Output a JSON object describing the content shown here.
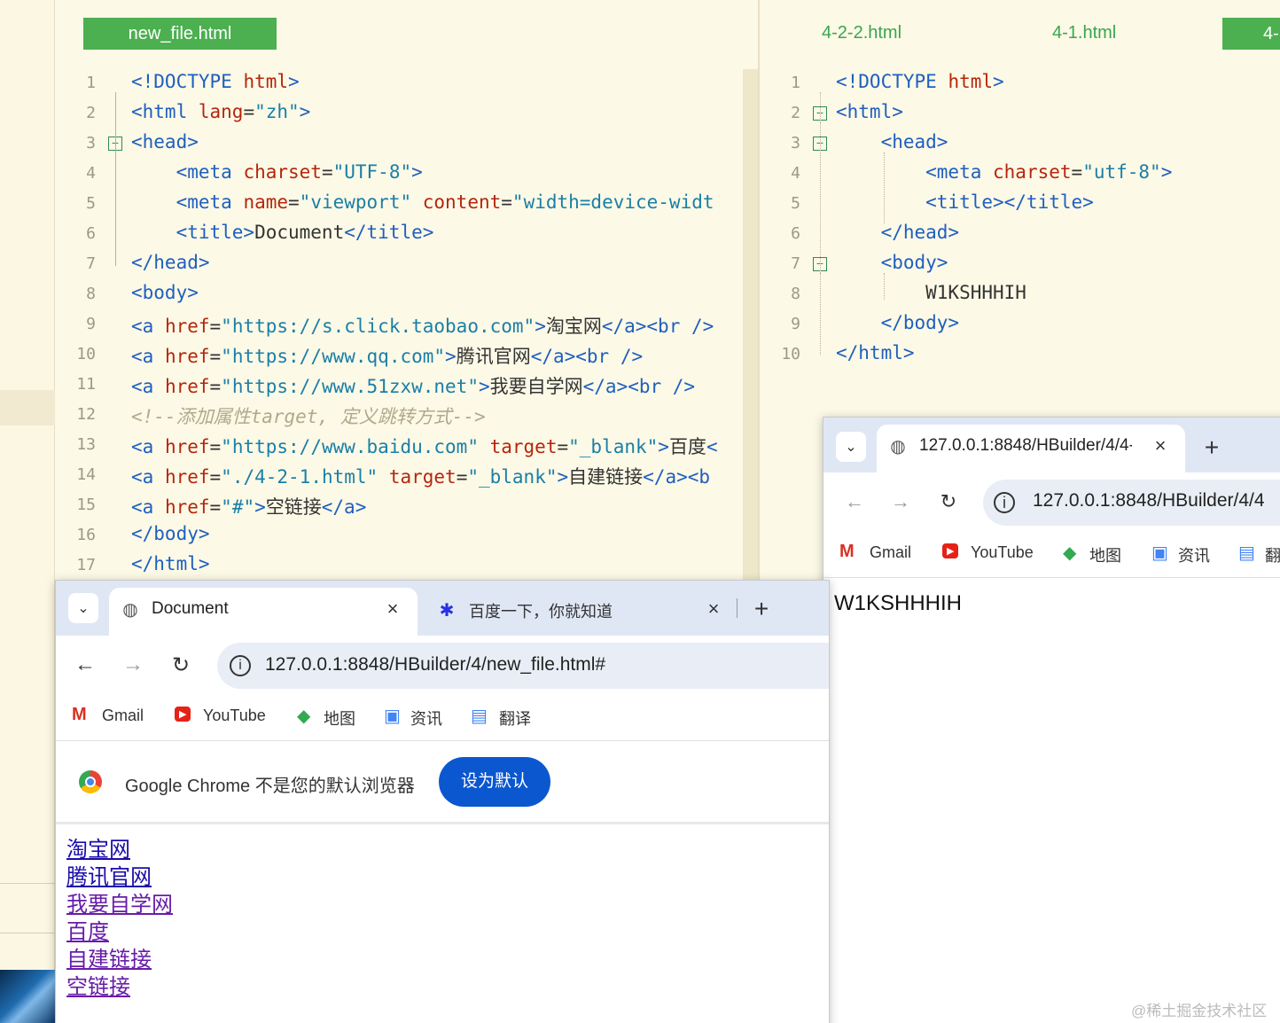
{
  "left_editor": {
    "tab": "new_file.html",
    "lines": [
      {
        "n": "1",
        "parts": [
          [
            "tg",
            "<!DOCTYPE "
          ],
          [
            "at",
            "html"
          ],
          [
            "tg",
            ">"
          ]
        ]
      },
      {
        "n": "2",
        "parts": [
          [
            "tg",
            "<html "
          ],
          [
            "at",
            "lang"
          ],
          [
            "tx",
            "="
          ],
          [
            "vl",
            "\"zh\""
          ],
          [
            "tg",
            ">"
          ]
        ]
      },
      {
        "n": "3",
        "parts": [
          [
            "tg",
            "<head>"
          ]
        ]
      },
      {
        "n": "4",
        "parts": [
          [
            "tg",
            "    <meta "
          ],
          [
            "at",
            "charset"
          ],
          [
            "tx",
            "="
          ],
          [
            "vl",
            "\"UTF-8\""
          ],
          [
            "tg",
            ">"
          ]
        ]
      },
      {
        "n": "5",
        "parts": [
          [
            "tg",
            "    <meta "
          ],
          [
            "at",
            "name"
          ],
          [
            "tx",
            "="
          ],
          [
            "vl",
            "\"viewport\" "
          ],
          [
            "at",
            "content"
          ],
          [
            "tx",
            "="
          ],
          [
            "vl",
            "\"width=device-widt"
          ]
        ]
      },
      {
        "n": "6",
        "parts": [
          [
            "tg",
            "    <title>"
          ],
          [
            "tx",
            "Document"
          ],
          [
            "tg",
            "</title>"
          ]
        ]
      },
      {
        "n": "7",
        "parts": [
          [
            "tg",
            "</head>"
          ]
        ]
      },
      {
        "n": "8",
        "parts": [
          [
            "tg",
            "<body>"
          ]
        ]
      },
      {
        "n": "9",
        "parts": [
          [
            "tg",
            "<a "
          ],
          [
            "at",
            "href"
          ],
          [
            "tx",
            "="
          ],
          [
            "vl",
            "\"https://s.click.taobao.com\""
          ],
          [
            "tg",
            ">"
          ],
          [
            "tx",
            "淘宝网"
          ],
          [
            "tg",
            "</a><br />"
          ]
        ]
      },
      {
        "n": "10",
        "parts": [
          [
            "tg",
            "<a "
          ],
          [
            "at",
            "href"
          ],
          [
            "tx",
            "="
          ],
          [
            "vl",
            "\"https://www.qq.com\""
          ],
          [
            "tg",
            ">"
          ],
          [
            "tx",
            "腾讯官网"
          ],
          [
            "tg",
            "</a><br />"
          ]
        ]
      },
      {
        "n": "11",
        "parts": [
          [
            "tg",
            "<a "
          ],
          [
            "at",
            "href"
          ],
          [
            "tx",
            "="
          ],
          [
            "vl",
            "\"https://www.51zxw.net\""
          ],
          [
            "tg",
            ">"
          ],
          [
            "tx",
            "我要自学网"
          ],
          [
            "tg",
            "</a><br />"
          ]
        ]
      },
      {
        "n": "12",
        "parts": [
          [
            "cm",
            "<!--添加属性target, 定义跳转方式-->"
          ]
        ]
      },
      {
        "n": "13",
        "parts": [
          [
            "tg",
            "<a "
          ],
          [
            "at",
            "href"
          ],
          [
            "tx",
            "="
          ],
          [
            "vl",
            "\"https://www.baidu.com\" "
          ],
          [
            "at",
            "target"
          ],
          [
            "tx",
            "="
          ],
          [
            "vl",
            "\"_blank\""
          ],
          [
            "tg",
            ">"
          ],
          [
            "tx",
            "百度"
          ],
          [
            "tg",
            "<"
          ]
        ]
      },
      {
        "n": "14",
        "parts": [
          [
            "tg",
            "<a "
          ],
          [
            "at",
            "href"
          ],
          [
            "tx",
            "="
          ],
          [
            "vl",
            "\"./4-2-1.html\" "
          ],
          [
            "at",
            "target"
          ],
          [
            "tx",
            "="
          ],
          [
            "vl",
            "\"_blank\""
          ],
          [
            "tg",
            ">"
          ],
          [
            "tx",
            "自建链接"
          ],
          [
            "tg",
            "</a><b"
          ]
        ]
      },
      {
        "n": "15",
        "parts": [
          [
            "tg",
            "<a "
          ],
          [
            "at",
            "href"
          ],
          [
            "tx",
            "="
          ],
          [
            "vl",
            "\"#\""
          ],
          [
            "tg",
            ">"
          ],
          [
            "tx",
            "空链接"
          ],
          [
            "tg",
            "</a>"
          ]
        ]
      },
      {
        "n": "16",
        "parts": [
          [
            "tg",
            "</body>"
          ]
        ]
      },
      {
        "n": "17",
        "parts": [
          [
            "tg",
            "</html>"
          ]
        ]
      }
    ]
  },
  "right_editor": {
    "tabs": [
      "4-2-2.html",
      "4-1.html",
      "4-"
    ],
    "lines": [
      {
        "n": "1",
        "parts": [
          [
            "tg",
            "<!DOCTYPE "
          ],
          [
            "at",
            "html"
          ],
          [
            "tg",
            ">"
          ]
        ]
      },
      {
        "n": "2",
        "parts": [
          [
            "tg",
            "<html>"
          ]
        ]
      },
      {
        "n": "3",
        "parts": [
          [
            "tg",
            "    <head>"
          ]
        ]
      },
      {
        "n": "4",
        "parts": [
          [
            "tg",
            "        <meta "
          ],
          [
            "at",
            "charset"
          ],
          [
            "tx",
            "="
          ],
          [
            "vl",
            "\"utf-8\""
          ],
          [
            "tg",
            ">"
          ]
        ]
      },
      {
        "n": "5",
        "parts": [
          [
            "tg",
            "        <title></title>"
          ]
        ]
      },
      {
        "n": "6",
        "parts": [
          [
            "tg",
            "    </head>"
          ]
        ]
      },
      {
        "n": "7",
        "parts": [
          [
            "tg",
            "    <body>"
          ]
        ]
      },
      {
        "n": "8",
        "parts": [
          [
            "tx",
            "        W1KSHHHIH"
          ]
        ]
      },
      {
        "n": "9",
        "parts": [
          [
            "tg",
            "    </body>"
          ]
        ]
      },
      {
        "n": "10",
        "parts": [
          [
            "tg",
            "</html>"
          ]
        ]
      }
    ]
  },
  "browser_left": {
    "tab1": "Document",
    "tab2": "百度一下，你就知道",
    "url": "127.0.0.1:8848/HBuilder/4/new_file.html#",
    "bookmarks": [
      "Gmail",
      "YouTube",
      "地图",
      "资讯",
      "翻译"
    ],
    "default_msg": "Google Chrome 不是您的默认浏览器",
    "default_btn": "设为默认",
    "links": [
      "淘宝网",
      "腾讯官网",
      "我要自学网",
      "百度",
      "自建链接",
      "空链接"
    ]
  },
  "browser_right": {
    "tab": "127.0.0.1:8848/HBuilder/4/4-",
    "url": "127.0.0.1:8848/HBuilder/4/4",
    "bookmarks": [
      "Gmail",
      "YouTube",
      "地图",
      "资讯",
      "翻"
    ],
    "content": "W1KSHHHIH"
  },
  "watermark": "@稀土掘金技术社区",
  "colors": {
    "tag": "#1f5fbf",
    "attr": "#b5260e",
    "value": "#1a7fa8",
    "comment": "#b0a98d",
    "tab_active": "#4caf50",
    "editor_bg": "#fcf9e6"
  }
}
